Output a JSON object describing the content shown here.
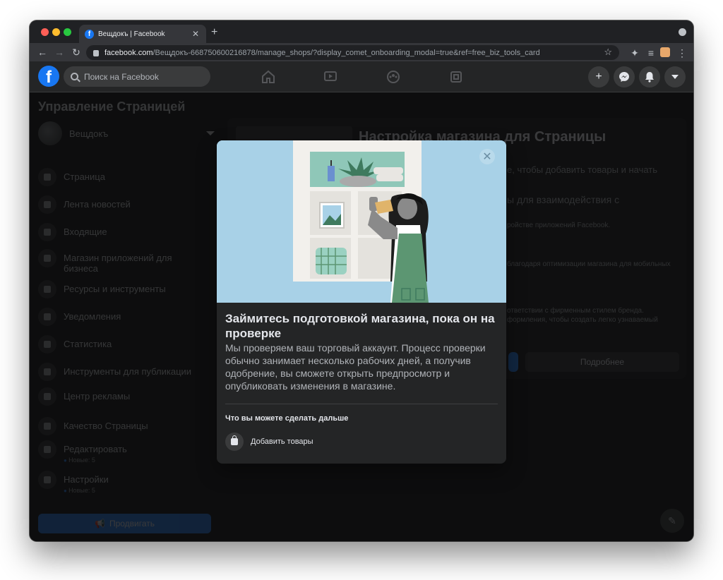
{
  "browser": {
    "tab_title": "Вещдокъ | Facebook",
    "url_host": "facebook.com",
    "url_path": "/Вещдокъ-668750600216878/manage_shops/?display_comet_onboarding_modal=true&ref=free_biz_tools_card"
  },
  "fb": {
    "logo": "f",
    "search_placeholder": "Поиск на Facebook"
  },
  "sidebar": {
    "title": "Управление Страницей",
    "page_name": "Вещдокъ",
    "items": [
      {
        "label": "Страница"
      },
      {
        "label": "Лента новостей"
      },
      {
        "label": "Входящие"
      },
      {
        "label": "Магазин приложений для бизнеса"
      },
      {
        "label": "Ресурсы и инструменты"
      },
      {
        "label": "Уведомления"
      },
      {
        "label": "Статистика"
      },
      {
        "label": "Инструменты для публикации"
      },
      {
        "label": "Центр рекламы"
      },
      {
        "label": "Качество Страницы"
      },
      {
        "label": "Редактировать",
        "sub": "Новые: 5"
      },
      {
        "label": "Настройки",
        "sub": "Новые: 5"
      }
    ],
    "promote": "Продвигать"
  },
  "main": {
    "title": "Настройка магазина для Страницы",
    "line1": "е, чтобы добавить товары и начать",
    "line2": "ы для взаимодействия с",
    "line3": "ройстве приложений Facebook.",
    "line4": "благодаря оптимизации магазина для мобильных",
    "line5": "ответствии с фирменным стилем бренда.",
    "line6": "формления, чтобы создать легко узнаваемый",
    "more_button": "Подробнее"
  },
  "modal": {
    "title": "Займитесь подготовкой магазина, пока он на проверке",
    "body": "Мы проверяем ваш торговый аккаунт. Процесс проверки обычно занимает несколько рабочих дней, а получив одобрение, вы сможете открыть предпросмотр и опубликовать изменения в магазине.",
    "next_heading": "Что вы можете сделать дальше",
    "action_label": "Добавить товары",
    "close_glyph": "✕"
  },
  "colors": {
    "fb_blue": "#1877f2",
    "hero_bg": "#a8d1e7",
    "apron": "#5c9672"
  }
}
